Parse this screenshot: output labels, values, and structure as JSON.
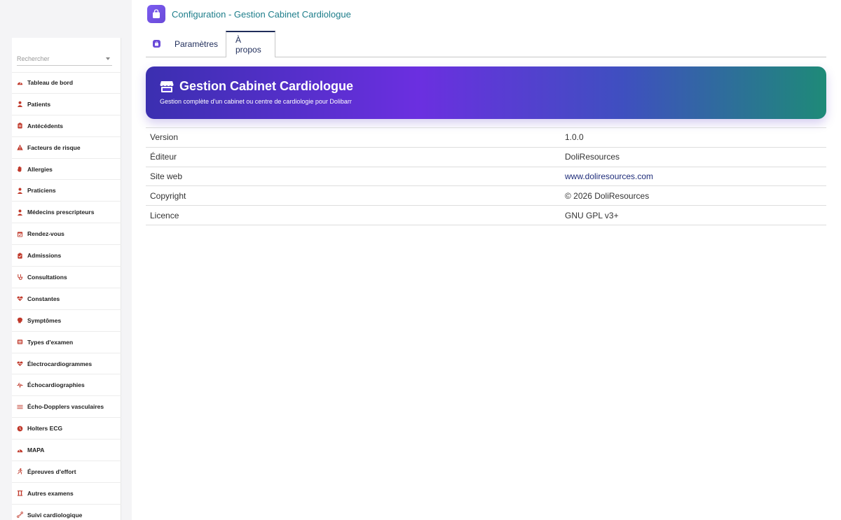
{
  "sidebar": {
    "search_placeholder": "Rechercher",
    "items": [
      {
        "label": "Tableau de bord",
        "icon": "dashboard-icon"
      },
      {
        "label": "Patients",
        "icon": "user-icon"
      },
      {
        "label": "Antécédents",
        "icon": "clipboard-icon"
      },
      {
        "label": "Facteurs de risque",
        "icon": "warning-icon"
      },
      {
        "label": "Allergies",
        "icon": "hand-icon"
      },
      {
        "label": "Praticiens",
        "icon": "doctor-icon"
      },
      {
        "label": "Médecins prescripteurs",
        "icon": "doctor-icon"
      },
      {
        "label": "Rendez-vous",
        "icon": "calendar-icon"
      },
      {
        "label": "Admissions",
        "icon": "clipboard-check-icon"
      },
      {
        "label": "Consultations",
        "icon": "stethoscope-icon"
      },
      {
        "label": "Constantes",
        "icon": "heartbeat-icon"
      },
      {
        "label": "Symptômes",
        "icon": "head-icon"
      },
      {
        "label": "Types d'examen",
        "icon": "list-icon"
      },
      {
        "label": "Électrocardiogrammes",
        "icon": "heart-pulse-icon"
      },
      {
        "label": "Échocardiographies",
        "icon": "wave-icon"
      },
      {
        "label": "Écho-Dopplers vasculaires",
        "icon": "lines-icon"
      },
      {
        "label": "Holters ECG",
        "icon": "clock-icon"
      },
      {
        "label": "MAPA",
        "icon": "gauge-icon"
      },
      {
        "label": "Épreuves d'effort",
        "icon": "running-icon"
      },
      {
        "label": "Autres examens",
        "icon": "flask-icon"
      },
      {
        "label": "Suivi cardiologique",
        "icon": "chart-icon"
      }
    ]
  },
  "header": {
    "title": "Configuration - Gestion Cabinet Cardiologue"
  },
  "tabs": [
    {
      "label": "Paramètres"
    },
    {
      "label": "À propos"
    }
  ],
  "banner": {
    "title": "Gestion Cabinet Cardiologue",
    "subtitle": "Gestion complète d'un cabinet ou centre de cardiologie pour Dolibarr"
  },
  "info": {
    "rows": [
      {
        "label": "Version",
        "value": "1.0.0"
      },
      {
        "label": "Éditeur",
        "value": "DoliResources"
      },
      {
        "label": "Site web",
        "value": "www.doliresources.com"
      },
      {
        "label": "Copyright",
        "value": "© 2026 DoliResources"
      },
      {
        "label": "Licence",
        "value": "GNU GPL v3+"
      }
    ]
  },
  "colors": {
    "accent": "#6a4ad8",
    "title": "#1d7d8a",
    "menu_icon": "#c0392b",
    "link": "#1f2d7a"
  }
}
